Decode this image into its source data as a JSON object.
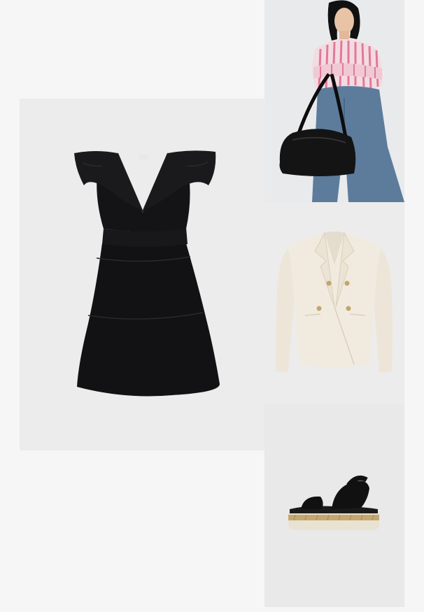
{
  "collage": {
    "items": [
      {
        "id": "dress",
        "icon": "black-ruffle-dress-image"
      },
      {
        "id": "model",
        "icon": "model-with-black-bag-image"
      },
      {
        "id": "blazer",
        "icon": "cream-blazer-image"
      },
      {
        "id": "sandal",
        "icon": "black-platform-sandal-image"
      }
    ]
  },
  "colors": {
    "page_background": "#f6f6f6",
    "tile_background": "#ececec",
    "dress": "#121214",
    "blazer": "#f1ebdf",
    "denim": "#5d7c9c",
    "shirt_stripe": "#e07a97",
    "sandal_sole": "#e8e2d2"
  }
}
